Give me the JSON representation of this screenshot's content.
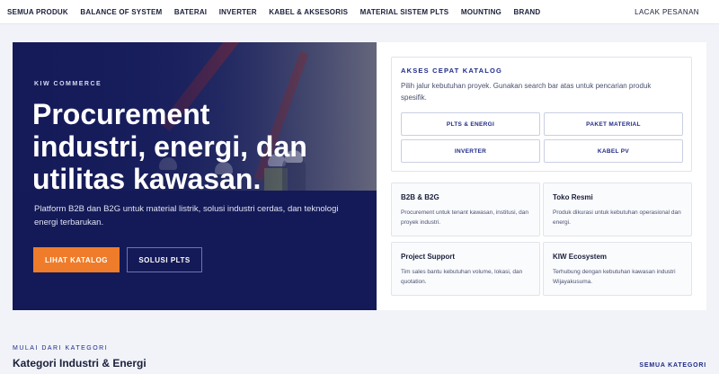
{
  "nav": {
    "links": [
      "SEMUA PRODUK",
      "BALANCE OF SYSTEM",
      "BATERAI",
      "INVERTER",
      "KABEL & AKSESORIS",
      "MATERIAL SISTEM PLTS",
      "MOUNTING",
      "BRAND"
    ],
    "track_order": "LACAK PESANAN"
  },
  "hero": {
    "eyebrow": "KIW COMMERCE",
    "title": "Procurement industri, energi, dan utilitas kawasan.",
    "subtitle": "Platform B2B dan B2G untuk material listrik, solusi industri cerdas, dan teknologi energi terbarukan.",
    "primary_button": "LIHAT KATALOG",
    "secondary_button": "SOLUSI PLTS"
  },
  "quick_access": {
    "title": "AKSES CEPAT KATALOG",
    "description": "Pilih jalur kebutuhan proyek. Gunakan search bar atas untuk pencarian produk spesifik.",
    "buttons": [
      "PLTS & ENERGI",
      "PAKET MATERIAL",
      "INVERTER",
      "KABEL PV"
    ]
  },
  "features": [
    {
      "title": "B2B & B2G",
      "text": "Procurement untuk tenant kawasan, institusi, dan proyek industri."
    },
    {
      "title": "Toko Resmi",
      "text": "Produk dikurasi untuk kebutuhan operasional dan energi."
    },
    {
      "title": "Project Support",
      "text": "Tim sales bantu kebutuhan volume, lokasi, dan quotation."
    },
    {
      "title": "KIW Ecosystem",
      "text": "Terhubung dengan kebutuhan kawasan industri Wijayakusuma."
    }
  ],
  "category": {
    "eyebrow": "MULAI DARI KATEGORI",
    "title": "Kategori Industri & Energi",
    "link": "SEMUA KATEGORI"
  }
}
